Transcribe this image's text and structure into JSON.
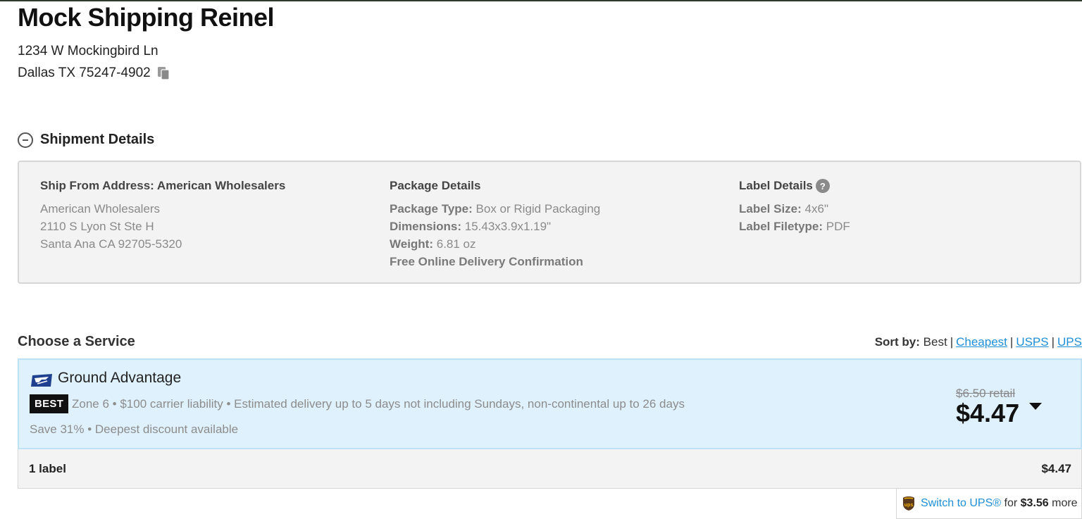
{
  "recipient": {
    "name": "Mock Shipping Reinel",
    "address_line1": "1234 W Mockingbird Ln",
    "address_line2": "Dallas TX 75247-4902"
  },
  "shipment_details": {
    "title": "Shipment Details",
    "ship_from": {
      "heading": "Ship From Address: American Wholesalers",
      "lines": [
        "American Wholesalers",
        "2110 S Lyon St Ste H",
        "Santa Ana CA 92705-5320"
      ]
    },
    "package": {
      "heading": "Package Details",
      "type_label": "Package Type:",
      "type_value": "Box or Rigid Packaging",
      "dimensions_label": "Dimensions:",
      "dimensions_value": "15.43x3.9x1.19\"",
      "weight_label": "Weight:",
      "weight_value": "6.81 oz",
      "confirmation": "Free Online Delivery Confirmation"
    },
    "label": {
      "heading": "Label Details",
      "help_icon_text": "?",
      "size_label": "Label Size:",
      "size_value": "4x6\"",
      "filetype_label": "Label Filetype:",
      "filetype_value": "PDF"
    }
  },
  "service": {
    "title": "Choose a Service",
    "sort": {
      "label": "Sort by:",
      "current": "Best",
      "options": [
        "Cheapest",
        "USPS",
        "UPS"
      ]
    },
    "selected": {
      "carrier_icon": "usps-eagle-icon",
      "name": "Ground Advantage",
      "badge": "BEST",
      "description": "Zone 6 • $100 carrier liability • Estimated delivery up to 5 days not including Sundays, non-continental up to 26 days",
      "savings": "Save 31% • Deepest discount available",
      "retail_price": "$6.50 retail",
      "price": "$4.47"
    },
    "summary": {
      "count": "1 label",
      "total": "$4.47"
    },
    "upsell": {
      "icon": "ups-shield-icon",
      "link_text": "Switch to UPS®",
      "middle_text": "for",
      "amount": "$3.56",
      "suffix": "more"
    }
  },
  "colors": {
    "link": "#1e8fd6",
    "selected_card_bg": "#dff1fc",
    "panel_bg": "#f3f3f3",
    "badge_bg": "#111111",
    "usps_blue": "#1f3f8f",
    "ups_brown": "#5b3a1e",
    "ups_gold": "#f5b400"
  }
}
